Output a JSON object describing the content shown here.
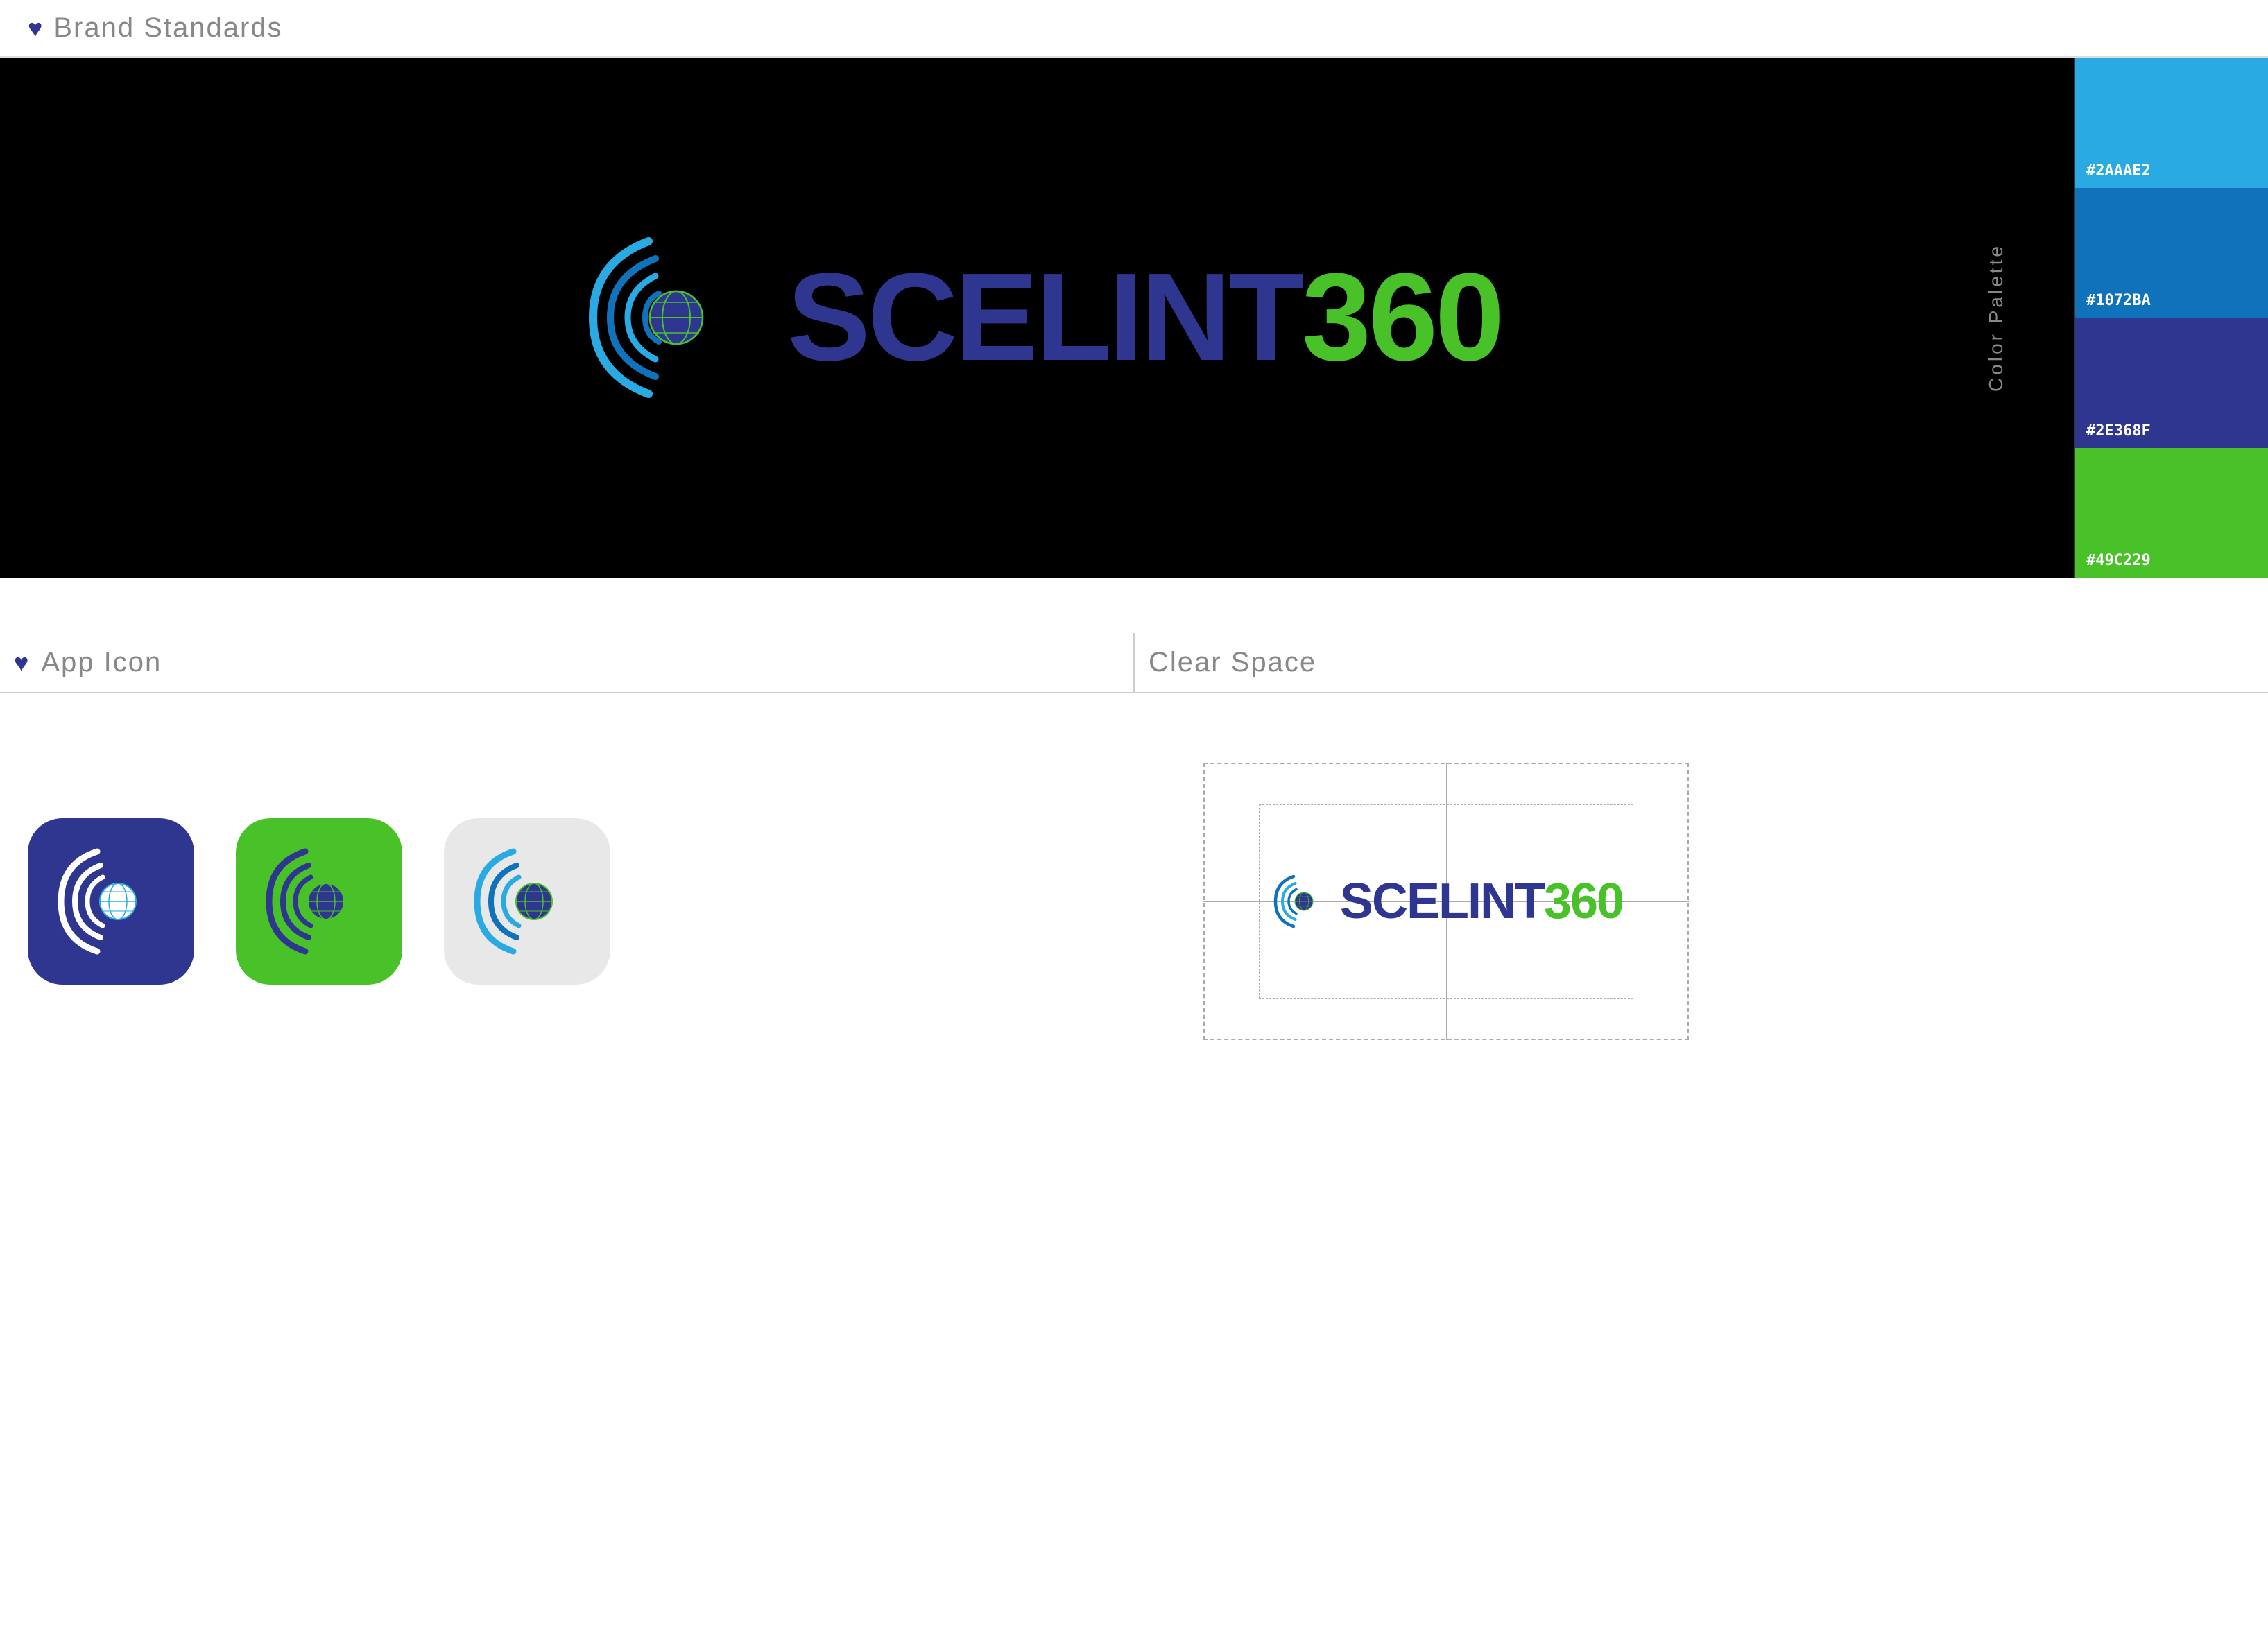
{
  "header": {
    "heart_icon": "♥",
    "title": "Brand  Standards"
  },
  "brand_section": {
    "logo": {
      "text_scelint": "SCELINT",
      "text_360": "360"
    },
    "color_palette": {
      "label": "Color Palette",
      "swatches": [
        {
          "hex": "#2AAAE2",
          "label": "#2AAAE2",
          "class": "swatch-2aaae2"
        },
        {
          "hex": "#1072BA",
          "label": "#1072BA",
          "class": "swatch-1072ba"
        },
        {
          "hex": "#2E368F",
          "label": "#2E368F",
          "class": "swatch-2e368f"
        },
        {
          "hex": "#49C229",
          "label": "#49C229",
          "class": "swatch-49c229"
        }
      ]
    }
  },
  "app_icon_section": {
    "heart_icon": "♥",
    "title": "App Icon"
  },
  "clear_space_section": {
    "title": "Clear Space",
    "logo_text_scelint": "SCELINT",
    "logo_text_360": "360"
  }
}
